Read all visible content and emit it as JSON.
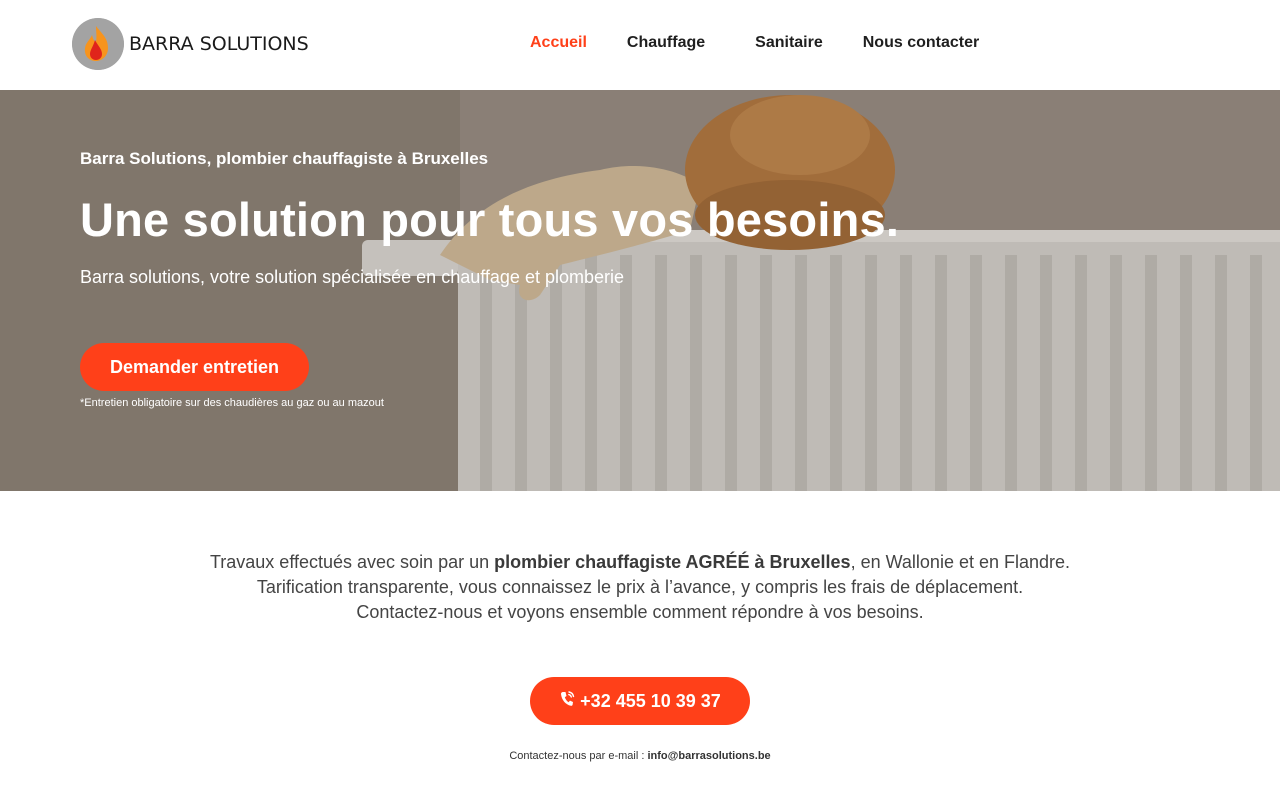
{
  "header": {
    "brand": "BARRA SOLUTIONS",
    "nav": [
      {
        "label": "Accueil",
        "active": true
      },
      {
        "label": "Chauffage",
        "active": false
      },
      {
        "label": "Sanitaire",
        "active": false
      },
      {
        "label": "Nous contacter",
        "active": false
      }
    ]
  },
  "hero": {
    "eyebrow": "Barra Solutions, plombier chauffagiste à Bruxelles",
    "title": "Une solution pour tous vos besoins.",
    "subtitle": "Barra solutions, votre solution spécialisée en chauffage et plomberie",
    "cta_label": "Demander entretien",
    "note": "*Entretien obligatoire sur des chaudières au gaz ou au mazout"
  },
  "intro": {
    "line1_prefix": "Travaux effectués avec soin par un ",
    "line1_bold": "plombier chauffagiste AGRÉÉ à Bruxelles",
    "line1_suffix": ", en Wallonie et en Flandre.",
    "line2": "Tarification transparente, vous connaissez le prix à l’avance, y compris les frais de déplacement.",
    "line3": "Contactez-nous et voyons ensemble comment répondre à vos besoins."
  },
  "contact": {
    "phone": "+32 455 10 39 37",
    "email_prefix": "Contactez-nous par e-mail : ",
    "email": "info@barrasolutions.be"
  },
  "colors": {
    "accent": "#ff4019",
    "nav_text": "#1f1f1f",
    "body_text": "#444444"
  },
  "icons": {
    "logo": "flame-drop-icon",
    "phone": "phone-ringing-icon"
  }
}
